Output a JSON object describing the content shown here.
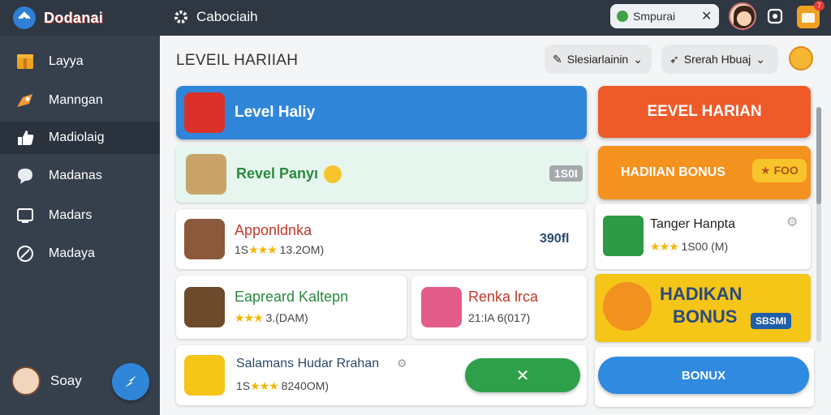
{
  "header": {
    "brand": "Dodanai",
    "app_title": "Cabociaih",
    "search_value": "Smpurai",
    "notification_count": "7"
  },
  "sidebar": {
    "items": [
      {
        "label": "Layya",
        "icon": "gift-icon"
      },
      {
        "label": "Manngan",
        "icon": "rocket-icon"
      },
      {
        "label": "Madiolaig",
        "icon": "thumbs-up-icon"
      },
      {
        "label": "Madanas",
        "icon": "chat-icon"
      },
      {
        "label": "Madars",
        "icon": "tv-icon"
      },
      {
        "label": "Madaya",
        "icon": "link-icon"
      }
    ],
    "user_name": "Soay"
  },
  "main": {
    "page_title": "LEVEIL HARIIAH",
    "filter1": "Slesiarlainin",
    "filter2": "Srerah Hbuaj",
    "left": {
      "banner": "Level Haliy",
      "revel_title": "Revel Panyı",
      "revel_value": "1S0I",
      "items": [
        {
          "title": "Apponldnka",
          "sub": "1S",
          "sub2": "13.2ОМ)",
          "value": "390fl"
        },
        {
          "title": "Eapreard Kaltepn",
          "sub": "",
          "sub2": "3.(DAM)"
        },
        {
          "title": "Renka lrca",
          "sub": "21:IA 6(017)"
        },
        {
          "title": "Salamans Hudar Rrahan",
          "sub": "1S",
          "sub2": "8240ОМ)"
        }
      ]
    },
    "right": {
      "banner1": "EEVEL HARIAN",
      "banner2": "HADIIAN BONUS",
      "banner2_badge": "FOO",
      "card_title": "Tanger Hanpta",
      "card_sub": "1S00 (M)",
      "promo_line1": "HADIKAN",
      "promo_line2": "BONUS",
      "promo_badge": "SBSMI",
      "bonus_button": "BONUX"
    }
  },
  "colors": {
    "blue": "#2f86d9",
    "green_light": "#e6f6ee",
    "orange_red": "#ef5a2a",
    "orange": "#f4921f",
    "green_button": "#2ea04a",
    "bonus_blue": "#2f8ae0"
  }
}
